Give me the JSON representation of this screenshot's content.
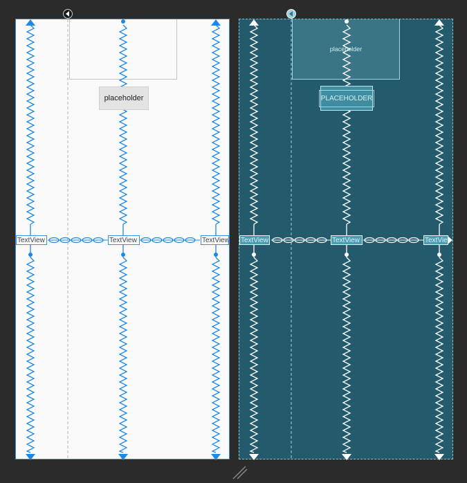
{
  "design": {
    "image_label": "",
    "button_label": "placeholder",
    "textviews": [
      "TextView",
      "TextView",
      "TextView"
    ]
  },
  "blueprint": {
    "image_label": "placeholder",
    "button_label": "PLACEHOLDER",
    "textviews": [
      "TextView",
      "TextView",
      "TextView"
    ]
  },
  "colors": {
    "canvas": "#2b2b2b",
    "design_bg": "#fafafa",
    "constraint": "#1e88e5",
    "blueprint_bg": "#235b6d",
    "blueprint_line": "#ffffff"
  },
  "icons": [
    "guideline-handle-icon",
    "constraint-arrow-icon",
    "resize-handle-icon"
  ]
}
